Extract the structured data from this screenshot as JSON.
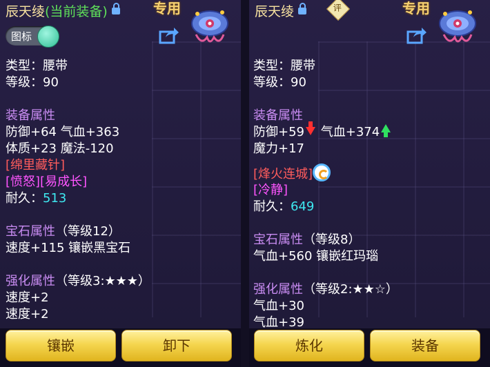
{
  "left": {
    "title_name": "辰天绫",
    "title_equipped": "(当前装备)",
    "exclusive": "专用",
    "toggle_label": "图标",
    "type_line": "类型：腰带",
    "level_line": "等级：90",
    "attr_header": "装备属性",
    "attr_line1": "防御+64 气血+363",
    "attr_line2": "体质+23 魔法-120",
    "tag1": "[绵里藏针]",
    "tag2": "[愤怒][易成长]",
    "durability_label": "耐久：",
    "durability_value": "513",
    "gem_header": "宝石属性",
    "gem_level": "（等级12）",
    "gem_line": "速度+115 镶嵌黑宝石",
    "enh_header": "强化属性",
    "enh_level": "（等级3:★★★）",
    "enh_line1": "速度+2",
    "enh_line2": "速度+2",
    "buttons": [
      "镶嵌",
      "卸下"
    ]
  },
  "right": {
    "title_name": "辰天绫",
    "eval_badge": "评",
    "exclusive": "专用",
    "type_line": "类型：腰带",
    "level_line": "等级：90",
    "attr_header": "装备属性",
    "attr_def": "防御+59",
    "attr_hp": "气血+374",
    "attr_line2": "魔力+17",
    "tag1": "[烽火连城]",
    "tag2": "[冷静]",
    "durability_label": "耐久：",
    "durability_value": "649",
    "gem_header": "宝石属性",
    "gem_level": "（等级8）",
    "gem_line": "气血+560 镶嵌红玛瑙",
    "enh_header": "强化属性",
    "enh_level": "（等级2:★★☆）",
    "enh_line1": "气血+30",
    "enh_line2": "气血+39",
    "buttons": [
      "炼化",
      "装备"
    ]
  },
  "colors": {
    "section": "#c98cf2",
    "special_tag": "#ff5c5c",
    "trait_tag": "#ff55ff",
    "durability": "#3ee8f0",
    "equipped": "#5fe05a",
    "button": "#f5d650"
  }
}
